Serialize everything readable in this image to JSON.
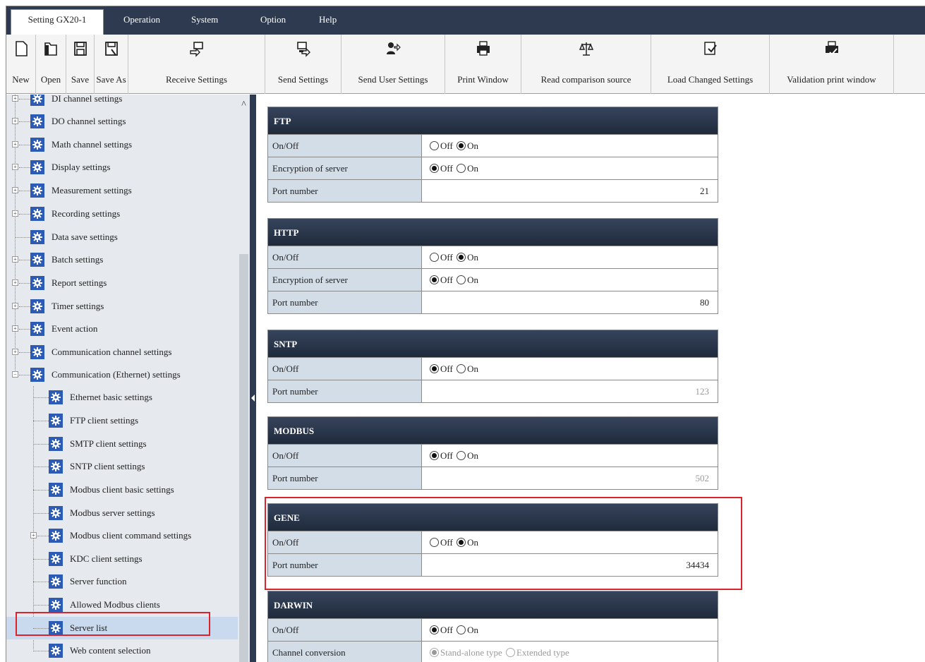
{
  "menu": {
    "setting_tab": "Setting GX20-1",
    "operation": "Operation",
    "system": "System",
    "option": "Option",
    "help": "Help"
  },
  "toolbar": {
    "new": "New",
    "open": "Open",
    "save": "Save",
    "save_as": "Save As",
    "receive_settings": "Receive Settings",
    "send_settings": "Send Settings",
    "send_user_settings": "Send User Settings",
    "print_window": "Print Window",
    "read_comparison_source": "Read comparison source",
    "load_changed_settings": "Load Changed Settings",
    "validation_print_window": "Validation print window"
  },
  "tree": {
    "items": [
      {
        "label": "DI channel settings"
      },
      {
        "label": "DO channel settings"
      },
      {
        "label": "Math channel settings"
      },
      {
        "label": "Display settings"
      },
      {
        "label": "Measurement settings"
      },
      {
        "label": "Recording settings"
      },
      {
        "label": "Data save settings"
      },
      {
        "label": "Batch settings"
      },
      {
        "label": "Report settings"
      },
      {
        "label": "Timer settings"
      },
      {
        "label": "Event action"
      },
      {
        "label": "Communication channel settings"
      },
      {
        "label": "Communication (Ethernet) settings"
      },
      {
        "label": "Ethernet basic settings"
      },
      {
        "label": "FTP client settings"
      },
      {
        "label": "SMTP client settings"
      },
      {
        "label": "SNTP client settings"
      },
      {
        "label": "Modbus client basic settings"
      },
      {
        "label": "Modbus server settings"
      },
      {
        "label": "Modbus client command settings"
      },
      {
        "label": "KDC client settings"
      },
      {
        "label": "Server function"
      },
      {
        "label": "Allowed Modbus clients"
      },
      {
        "label": "Server list"
      },
      {
        "label": "Web content selection"
      }
    ]
  },
  "labels": {
    "on_off": "On/Off",
    "encryption": "Encryption of server",
    "port_number": "Port number",
    "channel_conversion": "Channel conversion",
    "off": "Off",
    "on": "On",
    "stand_alone": "Stand-alone type",
    "extended": "Extended type"
  },
  "sections": {
    "ftp": {
      "title": "FTP",
      "port": "21"
    },
    "http": {
      "title": "HTTP",
      "port": "80"
    },
    "sntp": {
      "title": "SNTP",
      "port": "123"
    },
    "modbus": {
      "title": "MODBUS",
      "port": "502"
    },
    "gene": {
      "title": "GENE",
      "port": "34434"
    },
    "darwin": {
      "title": "DARWIN"
    }
  },
  "colors": {
    "menubar": "#2d3a4f",
    "highlight": "#d9232d",
    "row_label_bg": "#d3dde8",
    "tree_icon": "#2b5bb5"
  }
}
